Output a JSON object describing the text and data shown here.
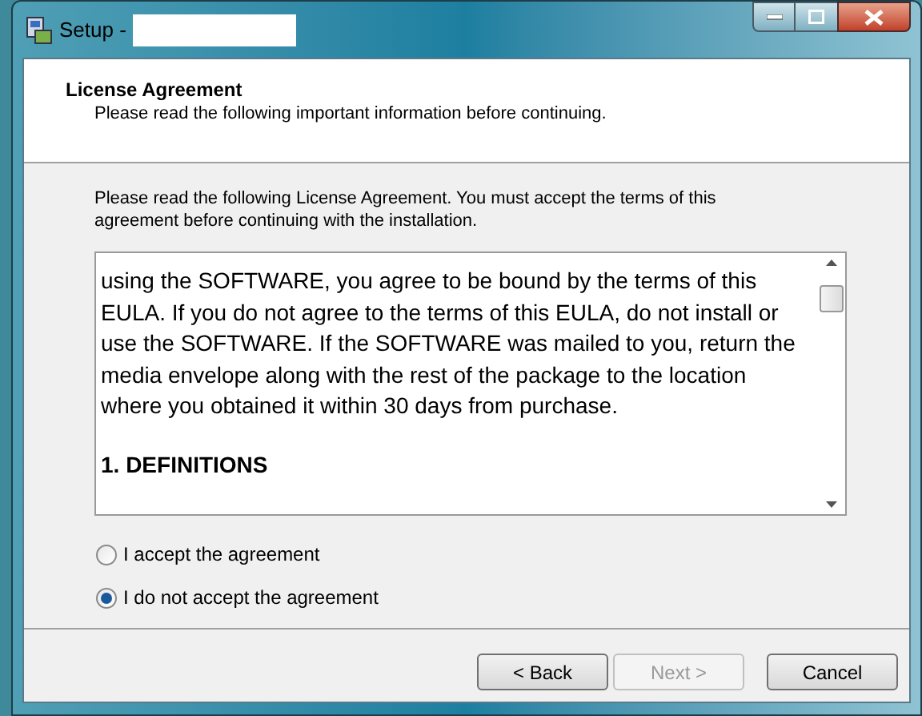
{
  "window": {
    "title": "Setup -"
  },
  "header": {
    "title": "License Agreement",
    "subtitle": "Please read the following important information before continuing."
  },
  "instructions": "Please read the following License Agreement. You must accept the terms of this agreement before continuing with the installation.",
  "license_text": [
    {
      "kind": "para",
      "text": "using the SOFTWARE, you agree to be bound by the terms of this EULA. If you do not agree to the terms of this EULA, do not install or use the SOFTWARE. If the SOFTWARE was mailed to you, return the media envelope along with the rest of the package to the location where you obtained it within 30 days from purchase."
    },
    {
      "kind": "heading",
      "text": "1. DEFINITIONS"
    }
  ],
  "options": [
    {
      "label": "I accept the agreement",
      "selected": false
    },
    {
      "label": "I do not accept the agreement",
      "selected": true
    }
  ],
  "buttons": [
    {
      "label": "< Back",
      "disabled": false
    },
    {
      "label": "Next >",
      "disabled": true
    },
    {
      "label": "Cancel",
      "disabled": false
    }
  ]
}
